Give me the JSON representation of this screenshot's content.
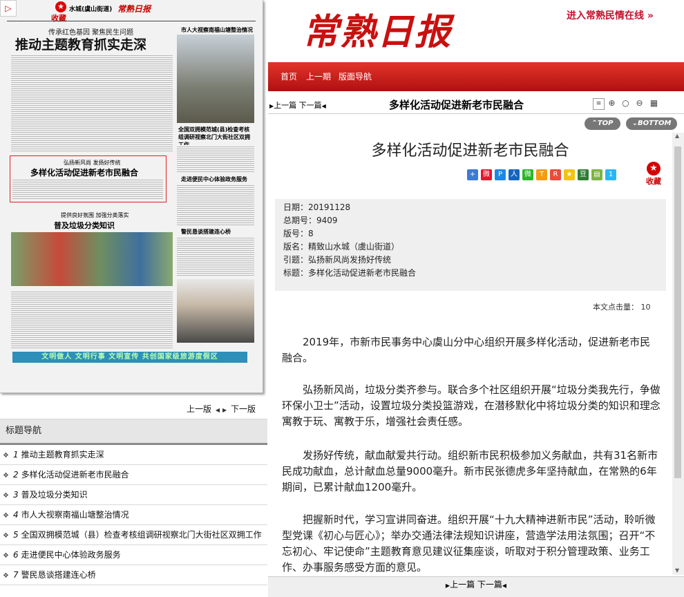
{
  "thumbnail": {
    "collect_mark": "收藏",
    "section_label": "水城(虞山街道)",
    "logo_text": "常熟日报",
    "kicker_1": "传承红色基因 聚焦民生问题",
    "title_1": "推动主题教育抓实走深",
    "side_kicker": "市人大视察南福山塘整治情况",
    "highlight_kicker": "弘扬新风尚 发扬好传统",
    "highlight_title": "多样化活动促进新老市民融合",
    "kicker_3": "提供良好氛围 加强分类落实",
    "title_3": "普及垃圾分类知识",
    "side_title_2": "全国双拥模范城(县)检查考核组调研视察北门大街社区双拥工作",
    "side_title_3": "走进便民中心体验政务服务",
    "side_title_4": "警民恳谈搭建连心桥",
    "banner": "文明做人 文明行事 文明宣传 共创国家级旅游度假区"
  },
  "page_nav": {
    "prev": "上一版",
    "next": "下一版"
  },
  "title_nav": {
    "header": "标题导航",
    "items": [
      {
        "num": "1",
        "label": "推动主题教育抓实走深"
      },
      {
        "num": "2",
        "label": "多样化活动促进新老市民融合"
      },
      {
        "num": "3",
        "label": "普及垃圾分类知识"
      },
      {
        "num": "4",
        "label": "市人大视察南福山塘整治情况"
      },
      {
        "num": "5",
        "label": "全国双拥模范城（县）检查考核组调研视察北门大街社区双拥工作"
      },
      {
        "num": "6",
        "label": "走进便民中心体验政务服务"
      },
      {
        "num": "7",
        "label": "警民恳谈搭建连心桥"
      }
    ]
  },
  "header": {
    "logo": "常熟日报",
    "minqing_link": "进入常熟民情在线"
  },
  "red_nav": {
    "home": "首页",
    "prev_issue": "上一期",
    "layout_nav": "版面导航"
  },
  "toolbar": {
    "prev": "上一篇",
    "next": "下一篇",
    "title": "多样化活动促进新老市民融合"
  },
  "scroll_buttons": {
    "top": "TOP",
    "bottom": "BOTTOM"
  },
  "article": {
    "title": "多样化活动促进新老市民融合",
    "collect_label": "收藏",
    "meta": [
      {
        "label": "日期",
        "value": "20191128"
      },
      {
        "label": "总期号",
        "value": "9409"
      },
      {
        "label": "版号",
        "value": "8"
      },
      {
        "label": "版名",
        "value": "精致山水城（虞山街道）"
      },
      {
        "label": "引题",
        "value": "弘扬新风尚发扬好传统"
      },
      {
        "label": "标题",
        "value": "多样化活动促进新老市民融合"
      }
    ],
    "hits_label": "本文点击量：",
    "hits_value": "10",
    "paragraphs": [
      "2019年，市新市民事务中心虞山分中心组织开展多样化活动，促进新老市民融合。",
      "弘扬新风尚，垃圾分类齐参与。联合多个社区组织开展“垃圾分类我先行，争做环保小卫士”活动，设置垃圾分类投篮游戏，在潜移默化中将垃圾分类的知识和理念寓教于玩、寓教于乐，增强社会责任感。",
      "发扬好传统，献血献爱共行动。组织新市民积极参加义务献血，共有31名新市民成功献血，总计献血总量9000毫升。新市民张德虎多年坚持献血，在常熟的6年期间，已累计献血1200毫升。",
      "把握新时代，学习宣讲同奋进。组织开展“十九大精神进新市民”活动，聆听微型党课《初心与匠心》；举办交通法律法规知识讲座，营造学法用法氛围；召开“不忘初心、牢记使命”主题教育意见建议征集座谈，听取对于积分管理政策、业务工作、办事服务感受方面的意见。"
    ]
  },
  "bottom_nav": {
    "prev": "上一篇",
    "next": "下一篇"
  },
  "colors": {
    "brand_red": "#c91010",
    "bar_red": "#d42a20"
  }
}
